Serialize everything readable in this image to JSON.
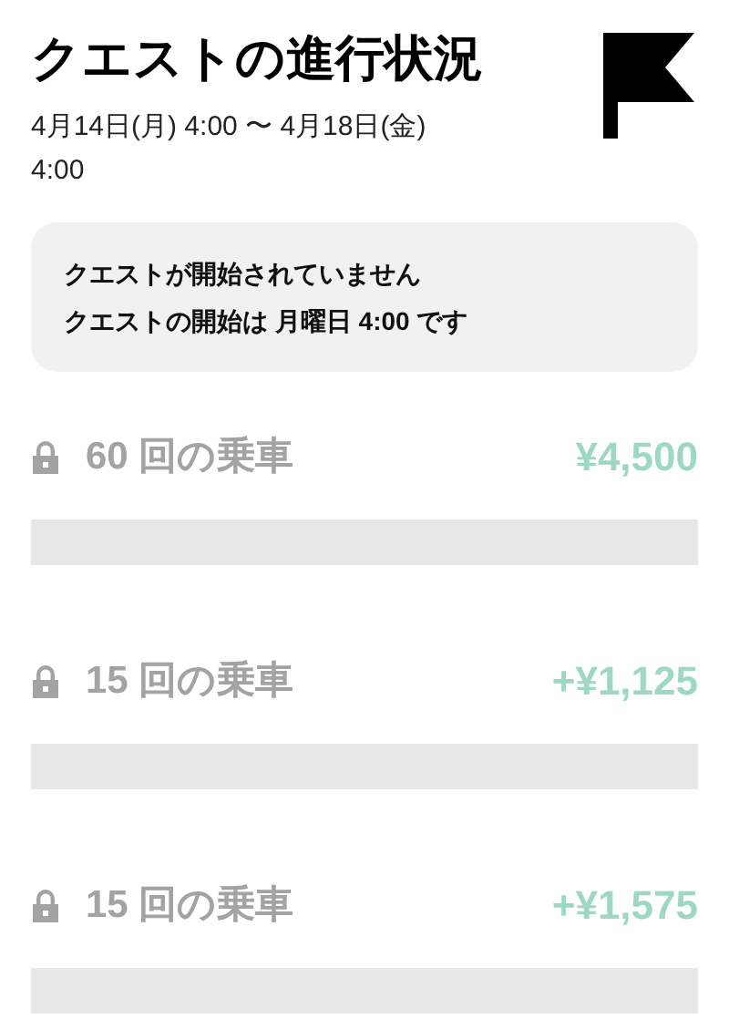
{
  "header": {
    "title": "クエストの進行状況",
    "period": "4月14日(月) 4:00 〜 4月18日(金)",
    "period_end": "4:00"
  },
  "notice": {
    "line_1": "クエストが開始されていません",
    "line_2": "クエストの開始は **月曜日** 4:00 です"
  },
  "tiers": [
    {
      "label": "60 回の乗車",
      "reward": "¥4,500",
      "locked": true,
      "level": 0
    },
    {
      "label": "15 回の乗車",
      "reward": "+¥1,125",
      "locked": true,
      "level": 0
    },
    {
      "label": "15 回の乗車",
      "reward": "+¥1,575",
      "locked": true,
      "level": 0
    }
  ]
}
